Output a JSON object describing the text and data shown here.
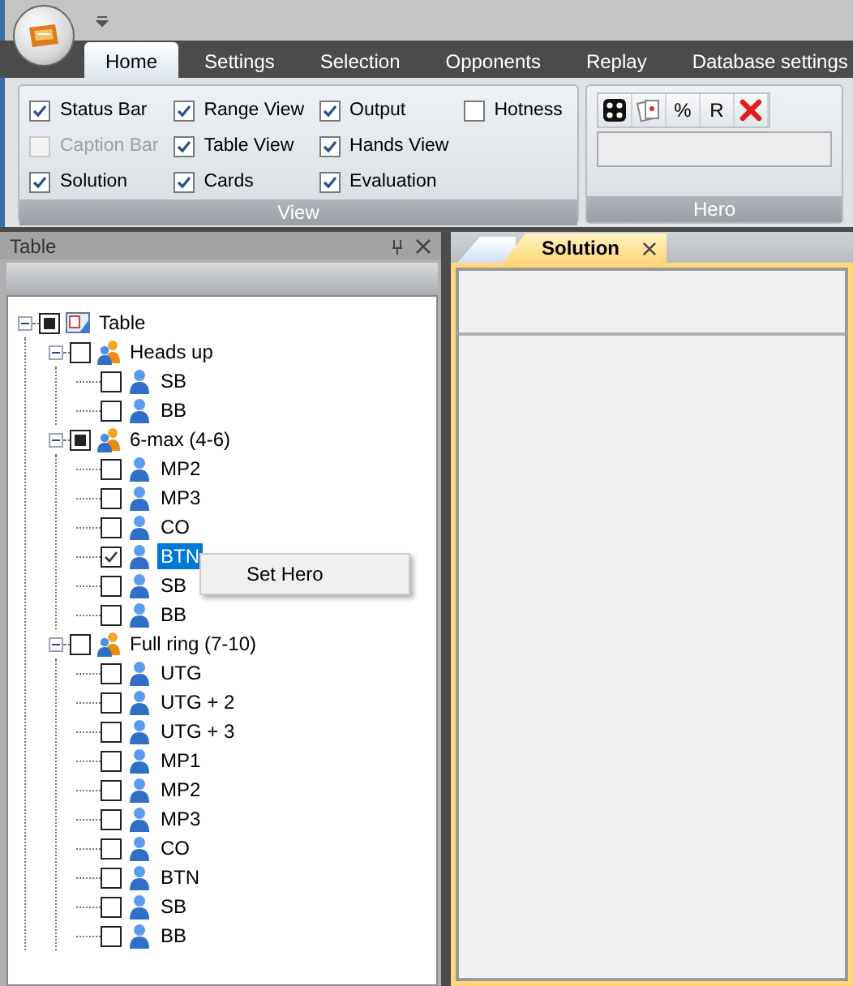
{
  "tabs": [
    {
      "label": "Home",
      "selected": true
    },
    {
      "label": "Settings",
      "selected": false
    },
    {
      "label": "Selection",
      "selected": false
    },
    {
      "label": "Opponents",
      "selected": false
    },
    {
      "label": "Replay",
      "selected": false
    },
    {
      "label": "Database settings",
      "selected": false
    }
  ],
  "view_group": {
    "title": "View",
    "options": [
      {
        "label": "Status Bar",
        "checked": true,
        "disabled": false
      },
      {
        "label": "Caption Bar",
        "checked": false,
        "disabled": true
      },
      {
        "label": "Solution",
        "checked": true,
        "disabled": false
      },
      {
        "label": "Range View",
        "checked": true,
        "disabled": false
      },
      {
        "label": "Table View",
        "checked": true,
        "disabled": false
      },
      {
        "label": "Cards",
        "checked": true,
        "disabled": false
      },
      {
        "label": "Output",
        "checked": true,
        "disabled": false
      },
      {
        "label": "Hands View",
        "checked": true,
        "disabled": false
      },
      {
        "label": "Evaluation",
        "checked": true,
        "disabled": false
      },
      {
        "label": "Hotness",
        "checked": false,
        "disabled": false
      }
    ]
  },
  "hero_group": {
    "title": "Hero",
    "tools": [
      {
        "kind": "dice"
      },
      {
        "kind": "cards"
      },
      {
        "kind": "text",
        "label": "%"
      },
      {
        "kind": "text",
        "label": "R"
      },
      {
        "kind": "delete"
      }
    ]
  },
  "panel": {
    "title": "Table",
    "tree": [
      {
        "label": "Table",
        "kind": "table",
        "checked": false,
        "partial": true,
        "expanded": true,
        "selected": false,
        "children": [
          {
            "label": "Heads up",
            "kind": "group",
            "checked": false,
            "partial": false,
            "expanded": true,
            "selected": false,
            "children": [
              {
                "label": "SB",
                "kind": "player",
                "checked": false,
                "partial": false,
                "selected": false
              },
              {
                "label": "BB",
                "kind": "player",
                "checked": false,
                "partial": false,
                "selected": false
              }
            ]
          },
          {
            "label": "6-max (4-6)",
            "kind": "group",
            "checked": false,
            "partial": true,
            "expanded": true,
            "selected": false,
            "children": [
              {
                "label": "MP2",
                "kind": "player",
                "checked": false,
                "partial": false,
                "selected": false
              },
              {
                "label": "MP3",
                "kind": "player",
                "checked": false,
                "partial": false,
                "selected": false
              },
              {
                "label": "CO",
                "kind": "player",
                "checked": false,
                "partial": false,
                "selected": false
              },
              {
                "label": "BTN",
                "kind": "player",
                "checked": true,
                "partial": false,
                "selected": true
              },
              {
                "label": "SB",
                "kind": "player",
                "checked": false,
                "partial": false,
                "selected": false
              },
              {
                "label": "BB",
                "kind": "player",
                "checked": false,
                "partial": false,
                "selected": false
              }
            ]
          },
          {
            "label": "Full ring (7-10)",
            "kind": "group",
            "checked": false,
            "partial": false,
            "expanded": true,
            "selected": false,
            "children": [
              {
                "label": "UTG",
                "kind": "player",
                "checked": false,
                "partial": false,
                "selected": false
              },
              {
                "label": "UTG + 2",
                "kind": "player",
                "checked": false,
                "partial": false,
                "selected": false
              },
              {
                "label": "UTG + 3",
                "kind": "player",
                "checked": false,
                "partial": false,
                "selected": false
              },
              {
                "label": "MP1",
                "kind": "player",
                "checked": false,
                "partial": false,
                "selected": false
              },
              {
                "label": "MP2",
                "kind": "player",
                "checked": false,
                "partial": false,
                "selected": false
              },
              {
                "label": "MP3",
                "kind": "player",
                "checked": false,
                "partial": false,
                "selected": false
              },
              {
                "label": "CO",
                "kind": "player",
                "checked": false,
                "partial": false,
                "selected": false
              },
              {
                "label": "BTN",
                "kind": "player",
                "checked": false,
                "partial": false,
                "selected": false
              },
              {
                "label": "SB",
                "kind": "player",
                "checked": false,
                "partial": false,
                "selected": false
              },
              {
                "label": "BB",
                "kind": "player",
                "checked": false,
                "partial": false,
                "selected": false
              }
            ]
          }
        ]
      }
    ]
  },
  "context_menu": {
    "items": [
      "Set Hero"
    ]
  },
  "document_tabs": [
    {
      "label": "Solution",
      "selected": true
    }
  ]
}
